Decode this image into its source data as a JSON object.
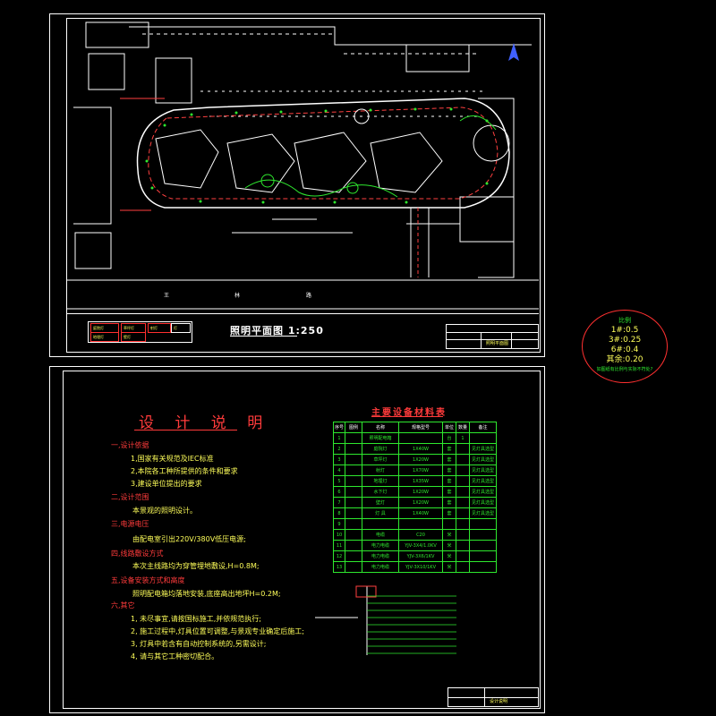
{
  "top_sheet": {
    "plan_title": "照明平面图 1:250",
    "road_labels": [
      "王",
      "林",
      "路"
    ],
    "legend_items": [
      "庭院灯",
      "草坪灯",
      "射灯",
      "地埋灯",
      "壁灯",
      "灯"
    ],
    "title_block_name": "照明平面图"
  },
  "scale_note": {
    "label": "比例",
    "lines": [
      "1#:0.5",
      "3#:0.25",
      "6#:0.4",
      "其余:0.20"
    ],
    "footer": "如图纸有比例与实际不符处?"
  },
  "bottom_sheet": {
    "design_title": "设 计 说 明",
    "sections": [
      {
        "heading": "一,设计依据",
        "items": [
          "1,国家有关规范及IEC标准",
          "2,本院各工种所提供的条件和要求",
          "3,建设单位提出的要求"
        ]
      },
      {
        "heading": "二,设计范围",
        "items": [
          "本景观的照明设计。"
        ]
      },
      {
        "heading": "三,电源电压",
        "items": [
          "由配电室引出220V/380V低压电源;"
        ]
      },
      {
        "heading": "四,线路敷设方式",
        "items": [
          "本次主线路均为穿管埋地敷设,H=0.8M;"
        ]
      },
      {
        "heading": "五,设备安装方式和高度",
        "items": [
          "照明配电箱均落地安装,底座高出地坪H=0.2M;"
        ]
      },
      {
        "heading": "六,其它",
        "items": [
          "1, 未尽事宜,请按国标施工,并依规范执行;",
          "2, 施工过程中,灯具位置可调整,与景观专业确定后施工;",
          "3, 灯具中若含有自动控制系统的,另需设计;",
          "4, 请与其它工种密切配合。"
        ]
      }
    ],
    "material_table": {
      "title": "主要设备材料表",
      "headers": [
        "序号",
        "图例",
        "名称",
        "规格型号",
        "单位",
        "数量",
        "备注"
      ],
      "rows": [
        [
          "1",
          "",
          "照明配电箱",
          "",
          "台",
          "1",
          ""
        ],
        [
          "2",
          "",
          "庭院灯",
          "1X40W",
          "套",
          "",
          "见灯具选型"
        ],
        [
          "3",
          "",
          "草坪灯",
          "1X20W",
          "套",
          "",
          "见灯具选型"
        ],
        [
          "4",
          "",
          "射灯",
          "1X70W",
          "套",
          "",
          "见灯具选型"
        ],
        [
          "5",
          "",
          "地埋灯",
          "1X35W",
          "套",
          "",
          "见灯具选型"
        ],
        [
          "6",
          "",
          "水下灯",
          "1X20W",
          "套",
          "",
          "见灯具选型"
        ],
        [
          "7",
          "",
          "壁灯",
          "1X20W",
          "套",
          "",
          "见灯具选型"
        ],
        [
          "8",
          "",
          "灯 具",
          "1X40W",
          "套",
          "",
          "见灯具选型"
        ],
        [
          "9",
          "",
          "",
          "",
          "",
          "",
          ""
        ],
        [
          "10",
          "",
          "电缆",
          "C20",
          "米",
          "",
          ""
        ],
        [
          "11",
          "",
          "电力电缆",
          "YJV-3X4/1.0KV",
          "米",
          "",
          ""
        ],
        [
          "12",
          "",
          "电力电缆",
          "YJV-3X6/1KV",
          "米",
          "",
          ""
        ],
        [
          "13",
          "",
          "电力电缆",
          "YJV-3X10/1KV",
          "米",
          "",
          ""
        ]
      ]
    },
    "title_block_name": "设计说明"
  }
}
